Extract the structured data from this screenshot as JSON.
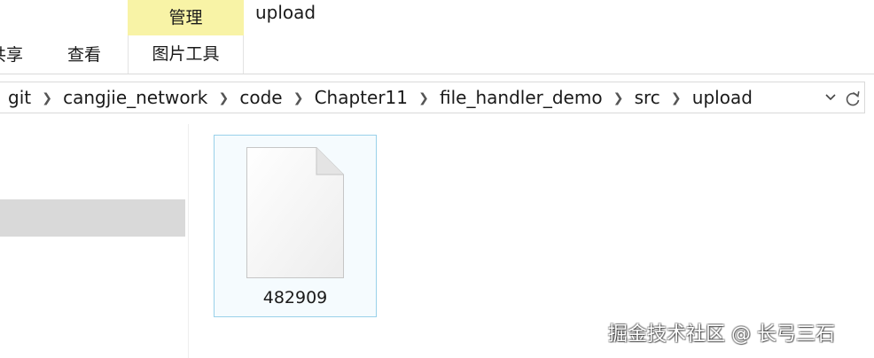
{
  "window": {
    "title": "upload"
  },
  "ribbon": {
    "contextual_group": "管理",
    "tabs": [
      {
        "label": "共享"
      },
      {
        "label": "查看"
      },
      {
        "label": "图片工具"
      }
    ],
    "contextual_color": "#f8f3a6"
  },
  "address_bar": {
    "crumbs": [
      "git",
      "cangjie_network",
      "code",
      "Chapter11",
      "file_handler_demo",
      "src",
      "upload"
    ],
    "separator_icon": "chevron-right-icon",
    "dropdown_icon": "chevron-down-icon",
    "refresh_icon": "refresh-icon"
  },
  "files": [
    {
      "name": "482909",
      "icon": "blank-file-icon",
      "selected": true
    }
  ],
  "watermark": {
    "text": "掘金技术社区 @ 长弓三石"
  },
  "colors": {
    "selection_border": "#99d1ea",
    "nav_selected": "#d9d9d9"
  }
}
